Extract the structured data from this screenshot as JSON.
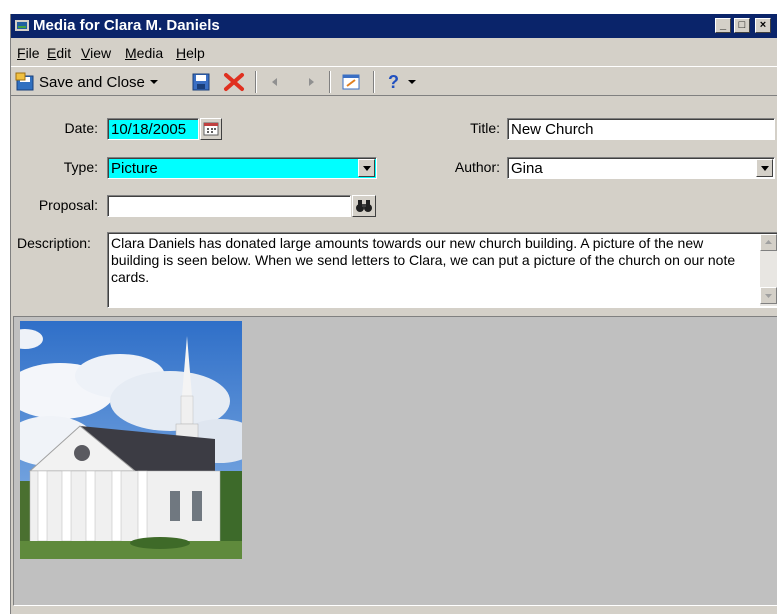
{
  "window": {
    "title": "Media for Clara M. Daniels"
  },
  "title_buttons": {
    "minimize": "_",
    "maximize": "□",
    "close": "×"
  },
  "menu": [
    {
      "label": "File",
      "ul": "F",
      "rest": "ile"
    },
    {
      "label": "Edit",
      "ul": "E",
      "rest": "dit"
    },
    {
      "label": "View",
      "ul": "V",
      "rest": "iew"
    },
    {
      "label": "Media",
      "ul": "M",
      "rest": "edia"
    },
    {
      "label": "Help",
      "ul": "H",
      "rest": "elp"
    }
  ],
  "toolbar": {
    "save_close_label": "Save and Close"
  },
  "form": {
    "date_label": "Date:",
    "date_value": "10/18/2005",
    "type_label": "Type:",
    "type_value": "Picture",
    "proposal_label": "Proposal:",
    "proposal_value": "",
    "description_label": "Description:",
    "description_value": "Clara Daniels has donated large amounts towards our new church building.  A picture of the new building is seen below.  When we send letters to Clara, we can put a picture of the church on our note cards.",
    "title_label": "Title:",
    "title_value": "New Church",
    "author_label": "Author:",
    "author_value": "Gina"
  },
  "colors": {
    "titlebar": "#0a246a",
    "highlight_field": "#00ffff",
    "window_face": "#d4d0c8",
    "media_background": "#c0c0c0"
  },
  "icons": [
    "app-icon",
    "save-close-icon",
    "save-icon",
    "delete-icon",
    "previous-icon",
    "next-icon",
    "properties-icon",
    "help-icon",
    "calendar-icon",
    "binoculars-icon"
  ]
}
